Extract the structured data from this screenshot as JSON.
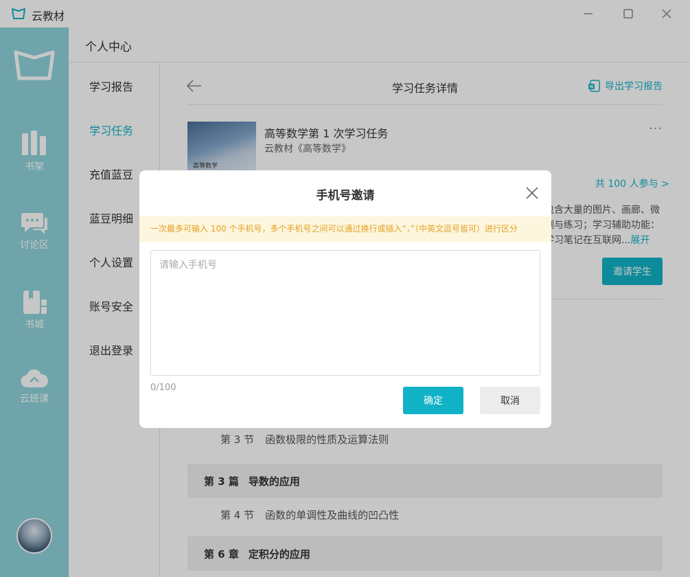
{
  "app": {
    "title": "云教材"
  },
  "sidebar": {
    "items": [
      {
        "label": "书架",
        "icon": "bookshelf-icon"
      },
      {
        "label": "讨论区",
        "icon": "chat-icon"
      },
      {
        "label": "书城",
        "icon": "bookstore-icon"
      },
      {
        "label": "云班课",
        "icon": "cloud-class-icon"
      }
    ]
  },
  "header": {
    "title": "个人中心"
  },
  "submenu": {
    "items": [
      {
        "label": "学习报告"
      },
      {
        "label": "学习任务",
        "active": true
      },
      {
        "label": "充值蓝豆"
      },
      {
        "label": "蓝豆明细"
      },
      {
        "label": "个人设置"
      },
      {
        "label": "账号安全"
      },
      {
        "label": "退出登录"
      }
    ]
  },
  "main": {
    "title": "学习任务详情",
    "export_label": "导出学习报告",
    "task": {
      "cover_text": "高等数学",
      "title": "高等数学第 1 次学习任务",
      "subtitle": "云教材《高等数学》",
      "more": "···",
      "participants": "共 100 人参与 >",
      "desc_line1": "包含大量的图片、画廊、微",
      "desc_line2": "测与练习；学习辅助功能：",
      "desc_line3": "学习笔记在互联网...",
      "desc_link": "展开",
      "invite_label": "邀请学生"
    },
    "contents": {
      "section_3": {
        "num": "第 3 节",
        "title": "函数极限的性质及运算法则"
      },
      "part_3": {
        "num": "第 3 篇",
        "title": "导数的应用"
      },
      "section_4": {
        "num": "第 4 节",
        "title": "函数的单调性及曲线的凹凸性"
      },
      "chapter_6": {
        "num": "第 6 章",
        "title": "定积分的应用"
      }
    }
  },
  "modal": {
    "title": "手机号邀请",
    "notice": "一次最多可输入 100 个手机号，多个手机号之间可以通过换行或插入“，”（中英文逗号皆可）进行区分",
    "input_placeholder": "请输入手机号",
    "input_value": "",
    "counter": "0/100",
    "ok_label": "确定",
    "cancel_label": "取消"
  },
  "colors": {
    "accent": "#11b2c6",
    "sidebar": "#8fd3dc",
    "notice_bg": "#fdf6de",
    "notice_text": "#e5a124"
  }
}
